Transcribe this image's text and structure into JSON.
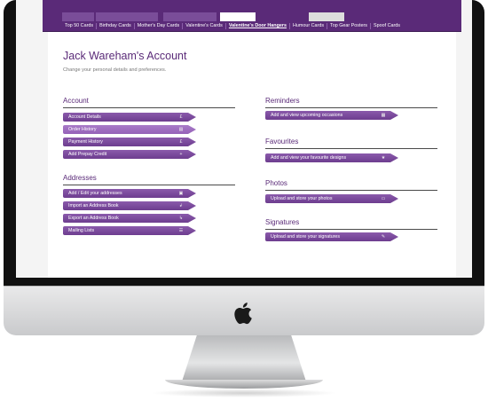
{
  "nav": {
    "categories": [
      {
        "label": "Top 50 Cards"
      },
      {
        "label": "Birthday Cards"
      },
      {
        "label": "Mother's Day Cards"
      },
      {
        "label": "Valentine's Cards"
      },
      {
        "label": "Valentine's Door Hangers",
        "active": true
      },
      {
        "label": "Humour Cards"
      },
      {
        "label": "Top Gear Posters"
      },
      {
        "label": "Spoof Cards"
      }
    ]
  },
  "header": {
    "title": "Jack Wareham's Account",
    "subtitle": "Change your personal details and preferences."
  },
  "sections": {
    "account": {
      "heading": "Account",
      "items": [
        {
          "label": "Account Details",
          "icon": "pound-icon"
        },
        {
          "label": "Order History",
          "icon": "document-icon"
        },
        {
          "label": "Payment History",
          "icon": "pound-document-icon"
        },
        {
          "label": "Add Prepay Credit",
          "icon": "add-credit-icon"
        }
      ]
    },
    "addresses": {
      "heading": "Addresses",
      "items": [
        {
          "label": "Add / Edit your addresses",
          "icon": "address-card-icon"
        },
        {
          "label": "Import an Address Book",
          "icon": "import-icon"
        },
        {
          "label": "Export an Address Book",
          "icon": "export-icon"
        },
        {
          "label": "Mailing Lists",
          "icon": "list-icon"
        }
      ]
    },
    "reminders": {
      "heading": "Reminders",
      "items": [
        {
          "label": "Add and view upcoming occasions",
          "icon": "calendar-icon"
        }
      ]
    },
    "favourites": {
      "heading": "Favourites",
      "items": [
        {
          "label": "Add and view your favourite designs",
          "icon": "star-icon"
        }
      ]
    },
    "photos": {
      "heading": "Photos",
      "items": [
        {
          "label": "Upload and store your photos",
          "icon": "photo-icon"
        }
      ]
    },
    "signatures": {
      "heading": "Signatures",
      "items": [
        {
          "label": "Upload and store your signatures",
          "icon": "pen-icon"
        }
      ]
    }
  },
  "colors": {
    "brand_purple": "#5a2a78",
    "button_purple": "#7a4a9c",
    "button_highlight": "#9d6bbd"
  }
}
